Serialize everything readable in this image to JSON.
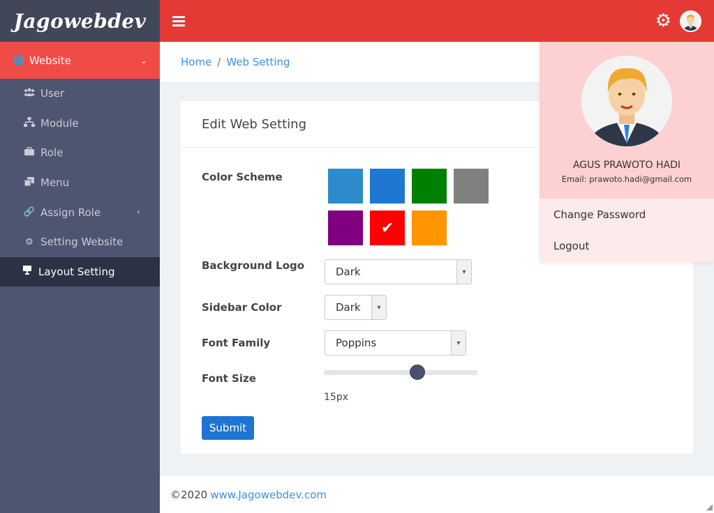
{
  "brand": {
    "name": "Jagowebdev"
  },
  "sidebar": {
    "parent": {
      "label": "Website",
      "icon": "globe-icon"
    },
    "items": [
      {
        "label": "User",
        "icon": "users-icon"
      },
      {
        "label": "Module",
        "icon": "sitemap-icon"
      },
      {
        "label": "Role",
        "icon": "briefcase-icon"
      },
      {
        "label": "Menu",
        "icon": "clone-icon"
      },
      {
        "label": "Assign Role",
        "icon": "link-icon"
      },
      {
        "label": "Setting Website",
        "icon": "gear-icon"
      },
      {
        "label": "Layout Setting",
        "icon": "desktop-icon"
      }
    ]
  },
  "breadcrumb": {
    "home": "Home",
    "separator": "/",
    "current": "Web Setting"
  },
  "card": {
    "title": "Edit Web Setting",
    "color_scheme_label": "Color Scheme",
    "colors": [
      "#2e8bcc",
      "#1e78d2",
      "#008000",
      "#808080",
      "#800080",
      "#ff0000",
      "#ff9500"
    ],
    "selected_color_index": 5,
    "background_logo": {
      "label": "Background Logo",
      "value": "Dark"
    },
    "sidebar_color": {
      "label": "Sidebar Color",
      "value": "Dark"
    },
    "font_family": {
      "label": "Font Family",
      "value": "Poppins"
    },
    "font_size": {
      "label": "Font Size",
      "value_text": "15px",
      "slider_fraction": 0.61
    },
    "submit_label": "Submit"
  },
  "footer": {
    "copyright": "©2020",
    "link": "www.Jagowebdev.com"
  },
  "profile": {
    "name": "AGUS PRAWOTO HADI",
    "email": "Email: prawoto.hadi@gmail.com",
    "menu": [
      "Change Password",
      "Logout"
    ]
  },
  "colors": {
    "topbar": "#e53935",
    "sidebar": "#4e5570",
    "active_menu": "#f04b47",
    "link": "#3d8ee6",
    "button": "#1e74d2"
  }
}
